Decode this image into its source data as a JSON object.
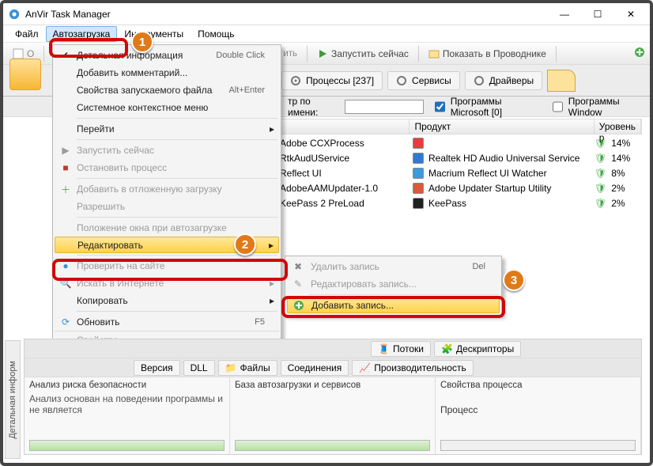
{
  "title": "AnVir Task Manager",
  "window": {
    "min": "—",
    "max": "☐",
    "close": "✕"
  },
  "menubar": [
    "Файл",
    "Автозагрузка",
    "Инструменты",
    "Помощь"
  ],
  "menubar_active_index": 1,
  "toolbar": {
    "launch": "Запустить сейчас",
    "show": "Показать в Проводнике",
    "more": "ить"
  },
  "tabs": {
    "processes": "Процессы [237]",
    "services": "Сервисы",
    "drivers": "Драйверы"
  },
  "filter": {
    "label": "тр по имени:",
    "value": "",
    "ms": "Программы Microsoft [0]",
    "win": "Программы Window"
  },
  "list": {
    "cols": {
      "product": "Продукт",
      "risk": "Уровень р"
    },
    "rows": [
      {
        "name": "Adobe CCXProcess",
        "product": "",
        "risk": "14%"
      },
      {
        "name": "RtkAudUService",
        "product": "Realtek HD Audio Universal Service",
        "risk": "14%"
      },
      {
        "name": "Reflect UI",
        "product": "Macrium Reflect UI Watcher",
        "risk": "8%"
      },
      {
        "name": "AdobeAAMUpdater-1.0",
        "product": "Adobe Updater Startup Utility",
        "risk": "2%"
      },
      {
        "name": "KeePass 2 PreLoad",
        "product": "KeePass",
        "risk": "2%"
      }
    ]
  },
  "menu1": {
    "detailed": "Детальная информация",
    "detailed_hot": "Double Click",
    "comment": "Добавить комментарий...",
    "props": "Свойства запускаемого файла",
    "props_hot": "Alt+Enter",
    "scm": "Системное контекстное меню",
    "goto": "Перейти",
    "run_now": "Запустить сейчас",
    "stop": "Остановить процесс",
    "delay": "Добавить в отложенную загрузку",
    "allow": "Разрешить",
    "winpos": "Положение окна при автозагрузке",
    "edit": "Редактировать",
    "check": "Проверить на сайте",
    "search": "Искать в Интернете",
    "copy": "Копировать",
    "refresh": "Обновить",
    "refresh_hot": "F5",
    "svojstva": "Свойства"
  },
  "menu2": {
    "del": "Удалить запись",
    "del_hot": "Del",
    "editrec": "Редактировать запись...",
    "add": "Добавить запись..."
  },
  "bottom": {
    "tabs_top": [
      "Потоки",
      "Дескрипторы"
    ],
    "tabs_bottom": [
      "Версия",
      "DLL",
      "Файлы",
      "Соединения",
      "Производительность"
    ],
    "pane1_hdr": "Анализ риска безопасности",
    "pane1_txt": "Анализ основан на поведении программы и не является",
    "pane2_hdr": "База автозагрузки и сервисов",
    "pane3_hdr": "Свойства процесса",
    "pane3_txt": "Процесс"
  },
  "sidetab": "Детальная информ",
  "callouts": {
    "n1": "1",
    "n2": "2",
    "n3": "3"
  }
}
